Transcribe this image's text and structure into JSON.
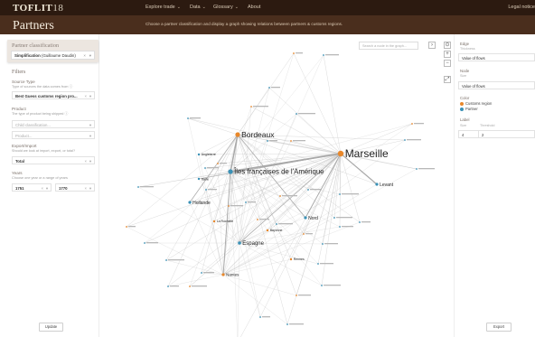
{
  "nav": {
    "brand": "TOFLIT",
    "brand_num": "18",
    "items": [
      {
        "label": "Explore trade",
        "has_dropdown": true
      },
      {
        "label": "Data",
        "has_dropdown": true
      },
      {
        "label": "Glossary",
        "has_dropdown": true
      },
      {
        "label": "About",
        "has_dropdown": false
      }
    ],
    "legal": "Legal notice"
  },
  "header": {
    "title": "Partners",
    "subtitle": "Choose a partner classification and display a graph showing relations between partners & customs regions."
  },
  "left_panel": {
    "partner_classification": {
      "title": "Partner classification",
      "value_bold": "Simplification",
      "value_rest": " (Guillaume Daudin)",
      "clear": "×",
      "dropdown": "▾"
    },
    "filters_title": "Filters",
    "source_type": {
      "label": "Source Type",
      "hint": "Type of sources the data comes from",
      "value": "Best Guess customs region pro..."
    },
    "product": {
      "label": "Product",
      "hint": "The type of product being shipped",
      "classification_placeholder": "Child classification...",
      "product_placeholder": "Product..."
    },
    "export_import": {
      "label": "Export/Import",
      "hint": "Should we look at import, export, or total?",
      "value": "Total"
    },
    "years": {
      "label": "Years",
      "hint": "Choose one year or a range of years",
      "from": "1751",
      "to": "1770"
    },
    "update_button": "Update"
  },
  "graph": {
    "search_placeholder": "Search a node in the graph...",
    "controls": [
      "⊙",
      "+",
      "−",
      "⤢"
    ]
  },
  "chart_data": {
    "type": "network",
    "nodes": [
      {
        "label": "Marseille",
        "category": "Customs region"
      },
      {
        "label": "Bordeaux",
        "category": "Customs region"
      },
      {
        "label": "Îles françaises de l'Amérique",
        "category": "Partner"
      },
      {
        "label": "Levant",
        "category": "Partner"
      },
      {
        "label": "Espagne",
        "category": "Partner"
      },
      {
        "label": "Hollande",
        "category": "Partner"
      },
      {
        "label": "Nord",
        "category": "Partner"
      },
      {
        "label": "Nantes",
        "category": "Customs region"
      },
      {
        "label": "Italie",
        "category": "Partner"
      },
      {
        "label": "Angleterre",
        "category": "Partner"
      },
      {
        "label": "Bayonne",
        "category": "Customs region"
      },
      {
        "label": "Rennes",
        "category": "Customs region"
      },
      {
        "label": "La Rochelle",
        "category": "Customs region"
      }
    ],
    "legend": [
      "Customs region",
      "Partner"
    ]
  },
  "right_panel": {
    "edge_title": "Edge",
    "edge_hint": "Thickness",
    "edge_value": "Value of flows",
    "node_title": "Node",
    "node_hint": "Size",
    "node_value": "Value of flows",
    "color_title": "Color",
    "legend": [
      {
        "label": "Customs region",
        "color": "#e8872a"
      },
      {
        "label": "Partner",
        "color": "#3a91b6"
      }
    ],
    "label_title": "Label",
    "label_size_hint": "Size",
    "label_threshold_hint": "Threshold",
    "label_size": "4",
    "label_threshold": "2",
    "export_button": "Export"
  }
}
